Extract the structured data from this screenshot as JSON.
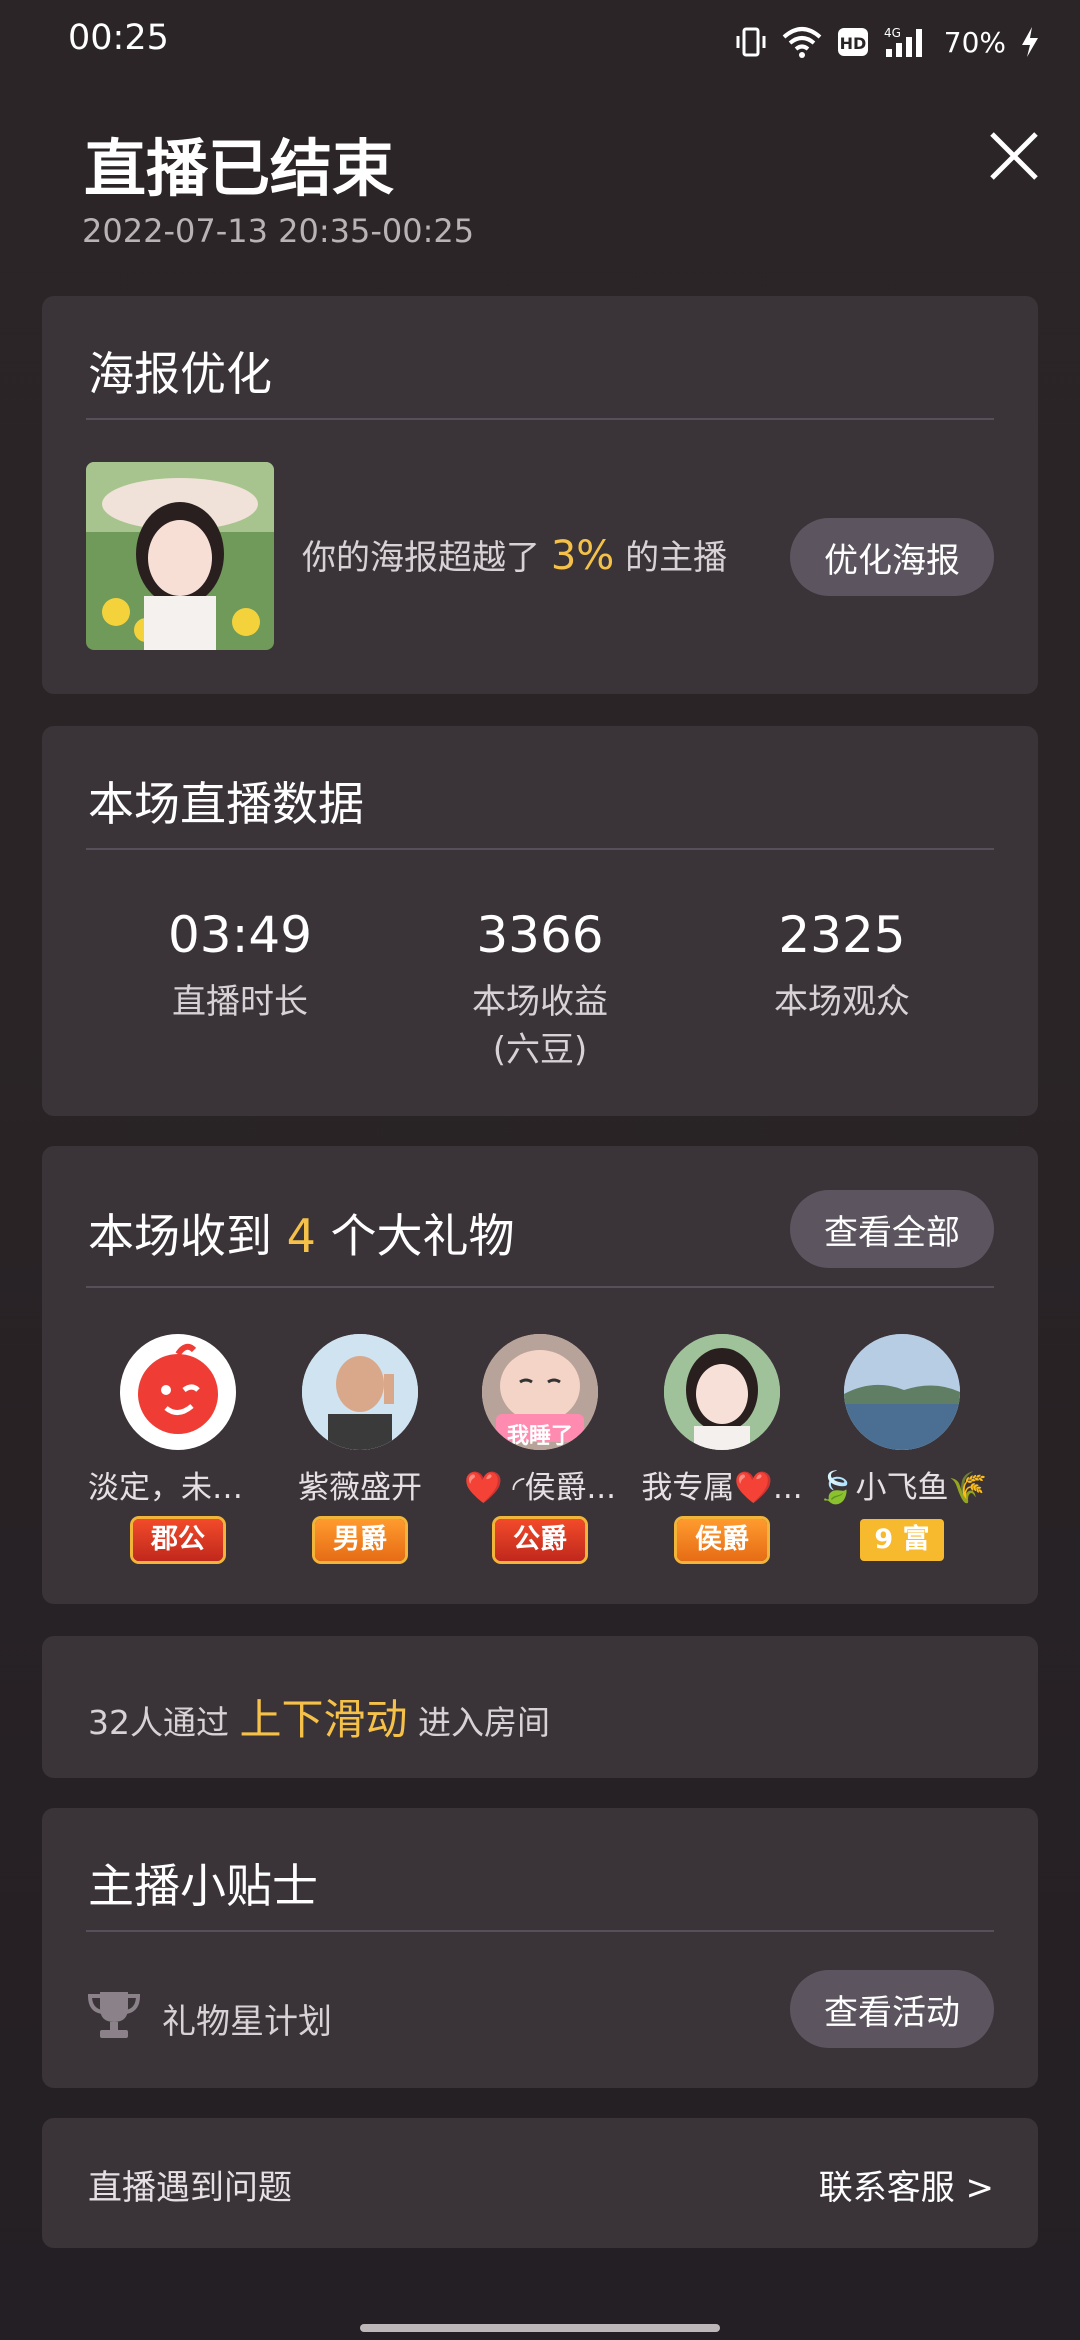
{
  "status_bar": {
    "time": "00:25",
    "battery": "70%",
    "icons": [
      "vibrate-icon",
      "wifi-icon",
      "hd-icon",
      "signal-4g-icon",
      "battery-charging-icon"
    ]
  },
  "header": {
    "title": "直播已结束",
    "time_range": "2022-07-13 20:35-00:25"
  },
  "poster": {
    "title": "海报优化",
    "text_prefix": "你的海报超越了",
    "percent": "3%",
    "text_suffix": "的主播",
    "button": "优化海报"
  },
  "stats": {
    "title": "本场直播数据",
    "items": [
      {
        "value": "03:49",
        "label": "直播时长",
        "sub": ""
      },
      {
        "value": "3366",
        "label": "本场收益",
        "sub": "(六豆)"
      },
      {
        "value": "2325",
        "label": "本场观众",
        "sub": ""
      }
    ]
  },
  "gifts": {
    "title_prefix": "本场收到",
    "count": "4",
    "title_suffix": "个大礼物",
    "button": "查看全部",
    "users": [
      {
        "name": "淡定，未来...",
        "badge": "郡公"
      },
      {
        "name": "紫薇盛开",
        "badge": "男爵"
      },
      {
        "name": "❤️ ◜侯爵...",
        "badge": "公爵"
      },
      {
        "name": "我专属❤️...",
        "badge": "侯爵"
      },
      {
        "name": "🍃小飞鱼🌾",
        "badge": "9 富"
      }
    ],
    "avatar_sticker_text": "我睡了"
  },
  "swipe": {
    "prefix": "32人通过",
    "highlight": "上下滑动",
    "suffix": "进入房间"
  },
  "tips": {
    "title": "主播小贴士",
    "item_label": "礼物星计划",
    "button": "查看活动"
  },
  "issue": {
    "label": "直播遇到问题",
    "link": "联系客服 >"
  },
  "colors": {
    "accent": "#f5c148",
    "card_bg": "#3a3439",
    "button_bg": "#5c5560"
  }
}
